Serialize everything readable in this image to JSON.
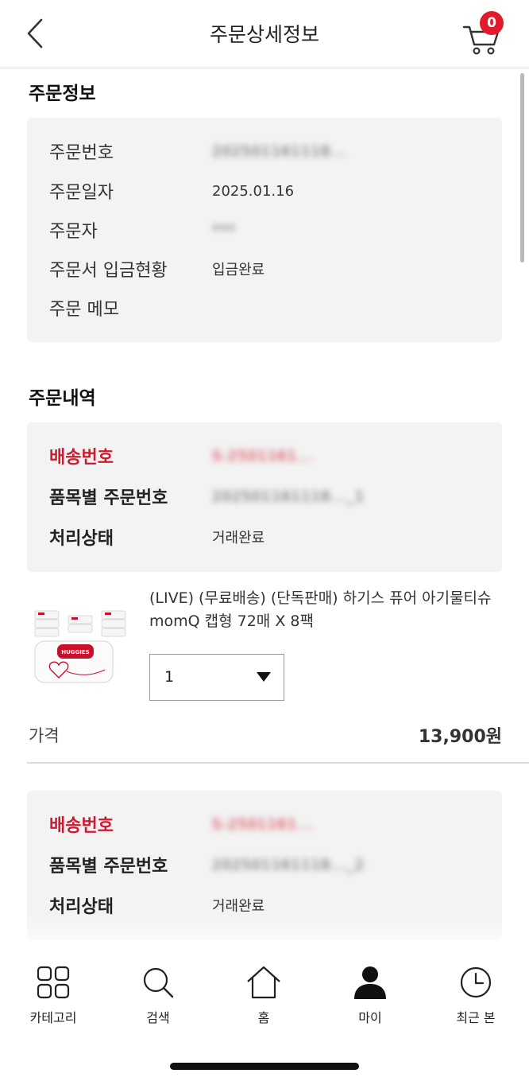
{
  "header": {
    "title": "주문상세정보",
    "cart_count": "0"
  },
  "order_info": {
    "title": "주문정보",
    "rows": [
      {
        "label": "주문번호",
        "value": "202501161118..."
      },
      {
        "label": "주문일자",
        "value": "2025.01.16"
      },
      {
        "label": "주문자",
        "value": "***"
      },
      {
        "label": "주문서 입금현황",
        "value": "입금완료"
      },
      {
        "label": "주문 메모",
        "value": ""
      }
    ]
  },
  "order_history": {
    "title": "주문내역",
    "shipments": [
      {
        "ship_label": "배송번호",
        "ship_value": "S-2501161...",
        "item_label": "품목별 주문번호",
        "item_value": "202501161118..._1",
        "status_label": "처리상태",
        "status_value": "거래완료"
      },
      {
        "ship_label": "배송번호",
        "ship_value": "S-2501161...",
        "item_label": "품목별 주문번호",
        "item_value": "202501161118..._2",
        "status_label": "처리상태",
        "status_value": "거래완료"
      }
    ],
    "product": {
      "title": "(LIVE) (무료배송) (단독판매) 하기스 퓨어 아기물티슈 momQ 캡형 72매 X 8팩",
      "brand_text": "HUGGIES",
      "quantity": "1"
    },
    "price_label": "가격",
    "price_value": "13,900원"
  },
  "tabbar": {
    "items": [
      {
        "label": "카테고리",
        "icon": "grid-icon"
      },
      {
        "label": "검색",
        "icon": "search-icon"
      },
      {
        "label": "홈",
        "icon": "home-icon"
      },
      {
        "label": "마이",
        "icon": "person-icon"
      },
      {
        "label": "최근 본",
        "icon": "clock-icon"
      }
    ]
  },
  "colors": {
    "accent": "#d0192f",
    "badge": "#e01c2c",
    "box_bg": "#f3f3f3"
  }
}
